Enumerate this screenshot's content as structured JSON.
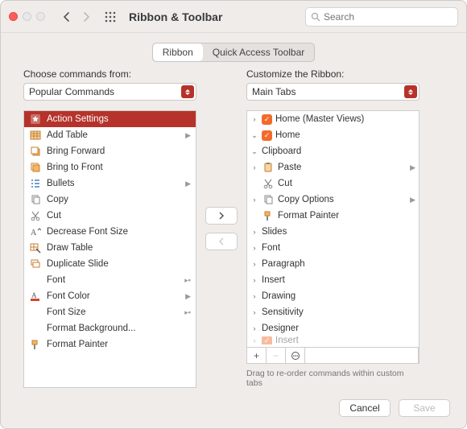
{
  "window": {
    "title": "Ribbon & Toolbar",
    "search_placeholder": "Search"
  },
  "tabs": {
    "ribbon": "Ribbon",
    "qat": "Quick Access Toolbar",
    "active": "ribbon"
  },
  "left": {
    "label": "Choose commands from:",
    "select_value": "Popular Commands",
    "items": [
      {
        "label": "Action Settings",
        "icon": "star",
        "selected": true
      },
      {
        "label": "Add Table",
        "icon": "table",
        "submenu": true
      },
      {
        "label": "Bring Forward",
        "icon": "bring-forward"
      },
      {
        "label": "Bring to Front",
        "icon": "bring-front"
      },
      {
        "label": "Bullets",
        "icon": "bullets",
        "submenu": true
      },
      {
        "label": "Copy",
        "icon": "copy"
      },
      {
        "label": "Cut",
        "icon": "cut"
      },
      {
        "label": "Decrease Font Size",
        "icon": "font-decrease"
      },
      {
        "label": "Draw Table",
        "icon": "draw-table"
      },
      {
        "label": "Duplicate Slide",
        "icon": "duplicate"
      },
      {
        "label": "Font",
        "icon": "blank",
        "submenu": true,
        "small_chev": true
      },
      {
        "label": "Font Color",
        "icon": "font-color",
        "submenu": true
      },
      {
        "label": "Font Size",
        "icon": "blank",
        "submenu": true,
        "small_chev": true
      },
      {
        "label": "Format Background...",
        "icon": "blank"
      },
      {
        "label": "Format Painter",
        "icon": "painter"
      }
    ]
  },
  "right": {
    "label": "Customize the Ribbon:",
    "select_value": "Main Tabs",
    "tree": [
      {
        "type": "tab",
        "expanded": false,
        "checked": true,
        "label": "Home (Master Views)",
        "depth": 0
      },
      {
        "type": "tab",
        "expanded": true,
        "checked": true,
        "label": "Home",
        "depth": 0
      },
      {
        "type": "group",
        "expanded": true,
        "label": "Clipboard",
        "depth": 1
      },
      {
        "type": "cmd",
        "expanded": false,
        "icon": "paste",
        "label": "Paste",
        "submenu": true,
        "depth": 2
      },
      {
        "type": "cmd",
        "icon": "cut",
        "label": "Cut",
        "depth": 3,
        "gray": true
      },
      {
        "type": "cmd",
        "expanded": false,
        "icon": "copy",
        "label": "Copy Options",
        "submenu": true,
        "depth": 2
      },
      {
        "type": "cmd",
        "icon": "painter",
        "label": "Format Painter",
        "depth": 3
      },
      {
        "type": "group",
        "expanded": false,
        "label": "Slides",
        "depth": 1
      },
      {
        "type": "group",
        "expanded": false,
        "label": "Font",
        "depth": 1
      },
      {
        "type": "group",
        "expanded": false,
        "label": "Paragraph",
        "depth": 1
      },
      {
        "type": "group",
        "expanded": false,
        "label": "Insert",
        "depth": 1
      },
      {
        "type": "group",
        "expanded": false,
        "label": "Drawing",
        "depth": 1
      },
      {
        "type": "group",
        "expanded": false,
        "label": "Sensitivity",
        "depth": 1
      },
      {
        "type": "group",
        "expanded": false,
        "label": "Designer",
        "depth": 1
      },
      {
        "type": "tab",
        "expanded": false,
        "checked": true,
        "label": "Insert",
        "depth": 0,
        "cut": true
      }
    ],
    "hint": "Drag to re-order commands within custom tabs"
  },
  "buttons": {
    "add": "›",
    "remove": "‹",
    "cancel": "Cancel",
    "save": "Save"
  }
}
